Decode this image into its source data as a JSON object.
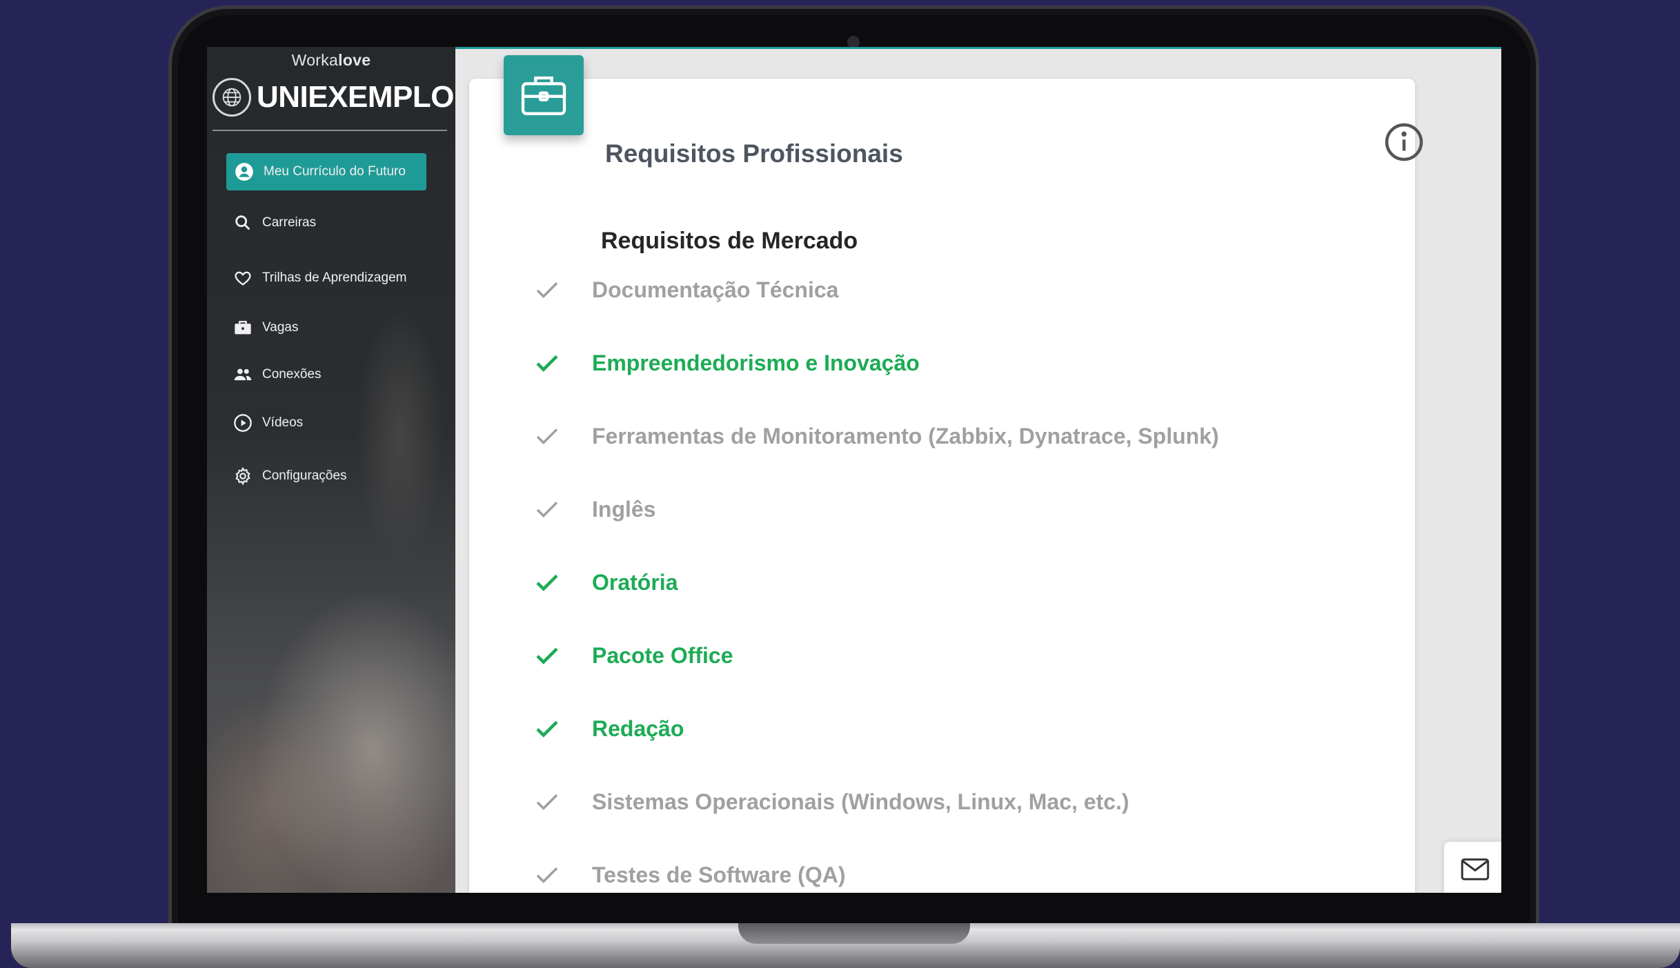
{
  "brand": {
    "prefix": "Worka",
    "suffix": "love",
    "institution": "UNIEXEMPLO"
  },
  "sidebar": {
    "items": [
      {
        "label": "Meu Currículo do Futuro",
        "icon": "account-circle-icon",
        "active": true
      },
      {
        "label": "Carreiras",
        "icon": "search-icon",
        "active": false
      },
      {
        "label": "Trilhas de Aprendizagem",
        "icon": "heart-icon",
        "active": false
      },
      {
        "label": "Vagas",
        "icon": "briefcase-icon",
        "active": false
      },
      {
        "label": "Conexões",
        "icon": "people-icon",
        "active": false
      },
      {
        "label": "Vídeos",
        "icon": "play-circle-icon",
        "active": false
      },
      {
        "label": "Configurações",
        "icon": "gear-icon",
        "active": false
      }
    ]
  },
  "main": {
    "card_title": "Requisitos Profissionais",
    "section_title": "Requisitos de Mercado",
    "requirements": [
      {
        "label": "Documentação Técnica",
        "met": false
      },
      {
        "label": "Empreendedorismo e Inovação",
        "met": true
      },
      {
        "label": "Ferramentas de Monitoramento (Zabbix, Dynatrace, Splunk)",
        "met": false
      },
      {
        "label": "Inglês",
        "met": false
      },
      {
        "label": "Oratória",
        "met": true
      },
      {
        "label": "Pacote Office",
        "met": true
      },
      {
        "label": "Redação",
        "met": true
      },
      {
        "label": "Sistemas Operacionais (Windows, Linux, Mac, etc.)",
        "met": false
      },
      {
        "label": "Testes de Software (QA)",
        "met": false
      }
    ]
  },
  "colors": {
    "accent_teal": "#1f9b97",
    "met_green": "#1dab55",
    "unmet_gray": "#a0a0a0",
    "background": "#262456"
  }
}
